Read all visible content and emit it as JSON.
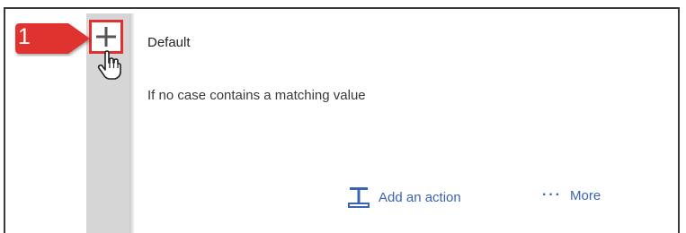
{
  "callout": {
    "number": "1",
    "color": "#e0302f"
  },
  "case_card": {
    "title": "Default",
    "description": "If no case contains a matching value",
    "add_action_label": "Add an action",
    "more_label": "More"
  },
  "icons": {
    "add_case": "plus-icon",
    "pointer": "hand-pointer-icon",
    "add_action": "add-action-icon",
    "more": "ellipsis-icon"
  },
  "colors": {
    "accent": "#3a63b8",
    "highlight": "#e0302f",
    "rail": "#d6d6d6"
  }
}
